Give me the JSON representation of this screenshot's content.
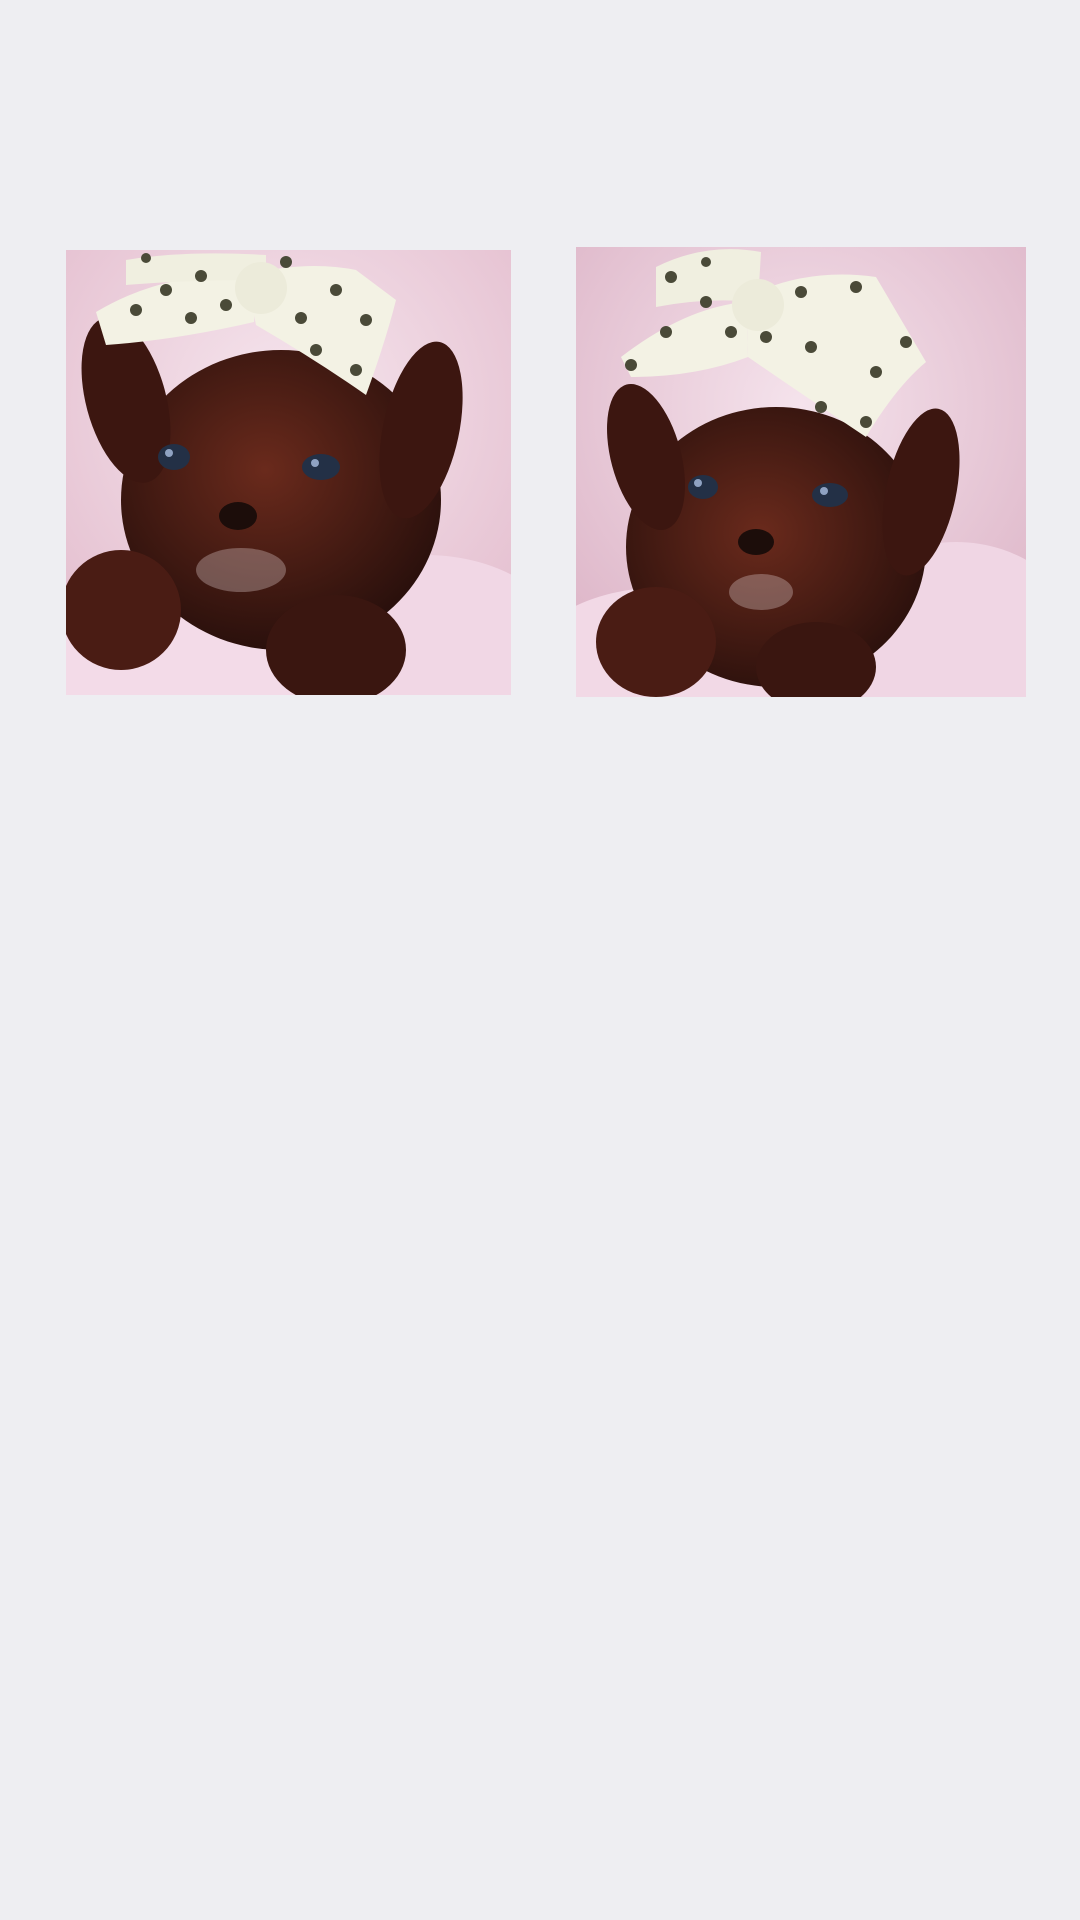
{
  "gallery": {
    "photos": [
      {
        "subject": "puppy-with-bow",
        "colors": {
          "fur": "#3a1812",
          "fur_light": "#6a2a1c",
          "bow": "#f3f2e4",
          "hearts": "#4a4a38",
          "blanket": "#f2d8e6",
          "blanket_shadow": "#e3bccd",
          "eyes": "#233046"
        }
      },
      {
        "subject": "puppy-with-bow",
        "colors": {
          "fur": "#3a1812",
          "fur_light": "#6a2a1c",
          "bow": "#f3f2e4",
          "hearts": "#4a4a38",
          "blanket": "#f2d8e6",
          "blanket_shadow": "#e3bccd",
          "eyes": "#233046"
        }
      }
    ]
  }
}
